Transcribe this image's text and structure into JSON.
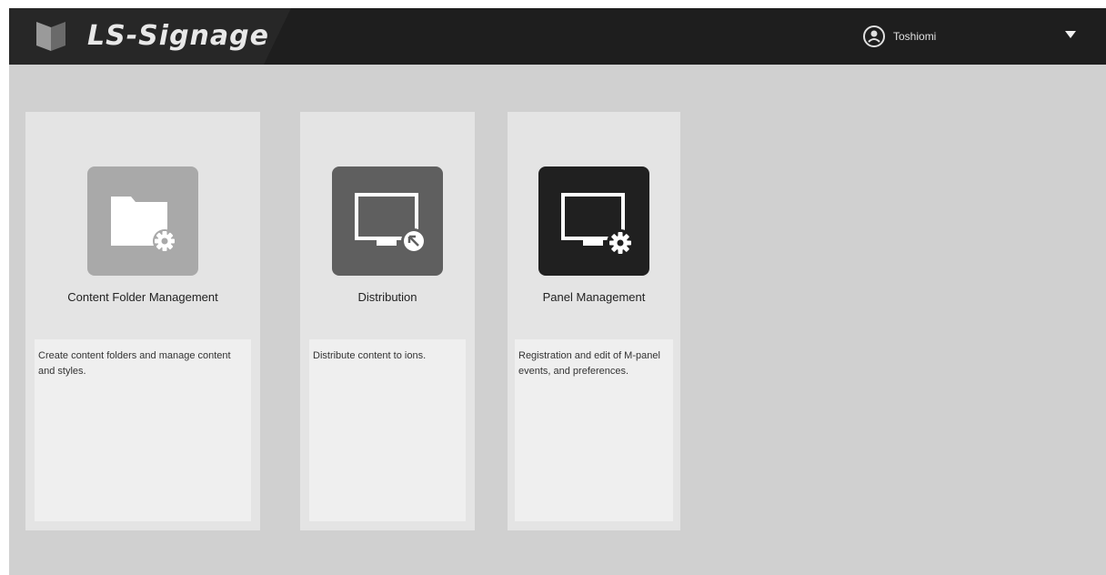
{
  "app": {
    "brand": "LS-Signage",
    "user_name": "Toshiomi"
  },
  "icons": {
    "logo": "logo-icon",
    "user": "user-icon",
    "dropdown": "chevron-down-icon",
    "content": "folder-gear-icon",
    "distribution": "monitor-arrow-icon",
    "panel": "monitor-gear-icon"
  },
  "colors": {
    "header": "#1e1e1e",
    "background": "#d0d0d0",
    "card": "#e4e4e4",
    "tile_content": "#a9a9a9",
    "tile_distribution": "#5f5f5f",
    "tile_panel": "#202020"
  },
  "cards": [
    {
      "title": "Content Folder Management",
      "description": "Create content folders and manage content and styles."
    },
    {
      "title": "Distribution",
      "description": "Distribute content to ions."
    },
    {
      "title": "Panel Management",
      "description": "Registration and edit of M-panel events, and preferences."
    }
  ]
}
